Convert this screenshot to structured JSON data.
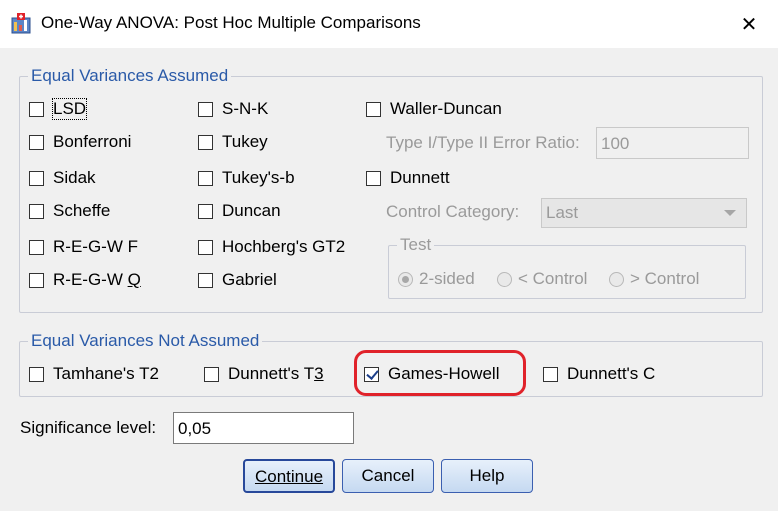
{
  "window": {
    "title": "One-Way ANOVA: Post Hoc Multiple Comparisons",
    "close_glyph": "✕"
  },
  "equal_assumed": {
    "legend": "Equal Variances Assumed",
    "lsd": "LSD",
    "bonferroni": "Bonferroni",
    "sidak": "Sidak",
    "scheffe": "Scheffe",
    "regwf": "R-E-G-W F",
    "regwq_prefix": "R-E-G-W ",
    "regwq_u": "Q",
    "snk": "S-N-K",
    "tukey": "Tukey",
    "tukeysb": "Tukey's-b",
    "duncan": "Duncan",
    "hochberg": "Hochberg's GT2",
    "gabriel": "Gabriel",
    "waller": "Waller-Duncan",
    "ratio_label": "Type I/Type II Error Ratio:",
    "ratio_value": "100",
    "dunnett": "Dunnett",
    "control_label": "Control Category:",
    "control_value": "Last",
    "test_legend": "Test",
    "two_sided": "2-sided",
    "lt_control": "< Control",
    "gt_control": "> Control"
  },
  "equal_not_assumed": {
    "legend": "Equal Variances Not Assumed",
    "tamhane": "Tamhane's T2",
    "t3_prefix": "Dunnett's T",
    "t3_u": "3",
    "games_howell": "Games-Howell",
    "games_howell_checked": true,
    "dunnett_c": "Dunnett's C"
  },
  "significance": {
    "label": "Significance level:",
    "value": "0,05"
  },
  "buttons": {
    "continue": "Continue",
    "cancel": "Cancel",
    "help": "Help"
  },
  "colors": {
    "highlight": "#e0222a",
    "legend_text": "#2a5aa8"
  },
  "icons": {
    "app": "spss-dialog-icon",
    "close": "close-icon"
  }
}
